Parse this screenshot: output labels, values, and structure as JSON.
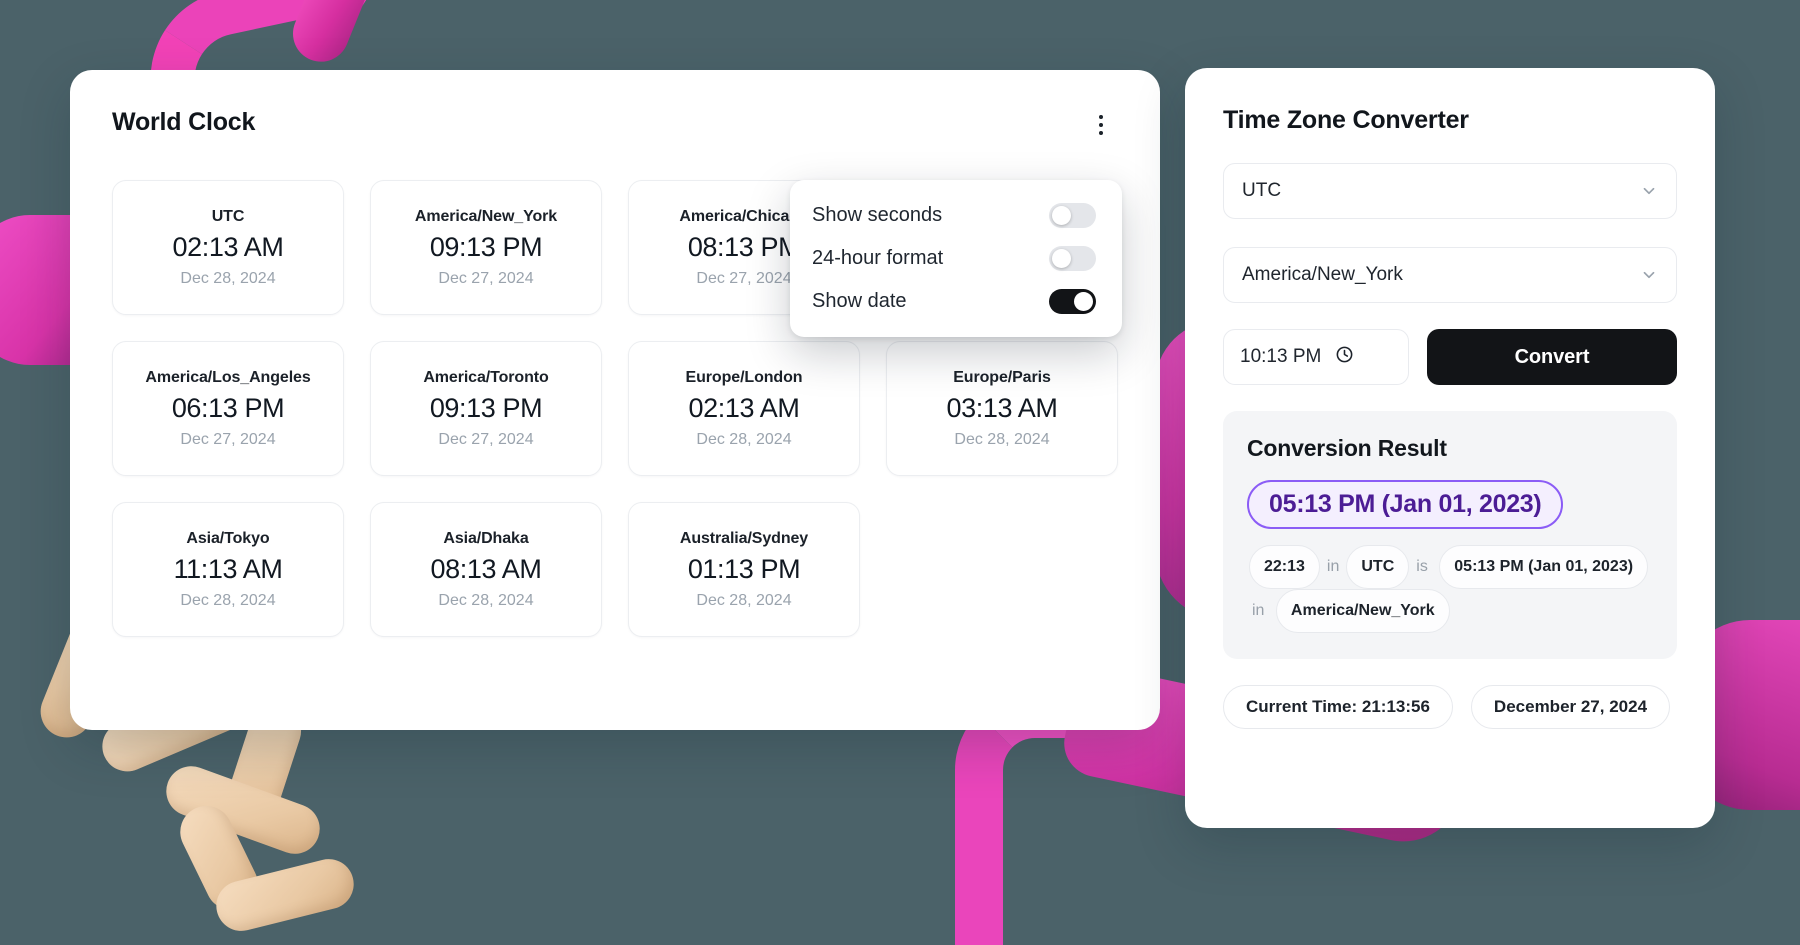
{
  "world_clock": {
    "title": "World Clock",
    "menu_icon": "kebab-menu-icon",
    "clocks": [
      {
        "zone": "UTC",
        "time": "02:13 AM",
        "date": "Dec 28, 2024"
      },
      {
        "zone": "America/New_York",
        "time": "09:13 PM",
        "date": "Dec 27, 2024"
      },
      {
        "zone": "America/Chicago",
        "time": "08:13 PM",
        "date": "Dec 27, 2024"
      },
      {
        "zone": "",
        "time": "",
        "date": ""
      },
      {
        "zone": "America/Los_Angeles",
        "time": "06:13 PM",
        "date": "Dec 27, 2024"
      },
      {
        "zone": "America/Toronto",
        "time": "09:13 PM",
        "date": "Dec 27, 2024"
      },
      {
        "zone": "Europe/London",
        "time": "02:13 AM",
        "date": "Dec 28, 2024"
      },
      {
        "zone": "Europe/Paris",
        "time": "03:13 AM",
        "date": "Dec 28, 2024"
      },
      {
        "zone": "Asia/Tokyo",
        "time": "11:13 AM",
        "date": "Dec 28, 2024"
      },
      {
        "zone": "Asia/Dhaka",
        "time": "08:13 AM",
        "date": "Dec 28, 2024"
      },
      {
        "zone": "Australia/Sydney",
        "time": "01:13 PM",
        "date": "Dec 28, 2024"
      }
    ]
  },
  "settings_menu": {
    "items": [
      {
        "label": "Show seconds",
        "enabled": false
      },
      {
        "label": "24-hour format",
        "enabled": false
      },
      {
        "label": "Show date",
        "enabled": true
      }
    ]
  },
  "converter": {
    "title": "Time Zone Converter",
    "from_zone": "UTC",
    "to_zone": "America/New_York",
    "time_value": "10:13 PM",
    "clock_icon": "clock-icon",
    "chevron_icon": "chevron-down-icon",
    "convert_label": "Convert",
    "result": {
      "title": "Conversion Result",
      "badge": "05:13 PM (Jan 01, 2023)",
      "source_time": "22:13",
      "connector_1": "in",
      "source_zone": "UTC",
      "connector_2": "is",
      "target_time": "05:13 PM (Jan 01, 2023)",
      "connector_3": "in",
      "target_zone": "America/New_York"
    },
    "status": {
      "current_time": "Current Time: 21:13:56",
      "current_date": "December 27, 2024"
    }
  },
  "colors": {
    "background": "#4b6269",
    "accent_purple": "#8b5cf6",
    "result_text": "#4c1d95",
    "button_dark": "#121417",
    "pink_decor": "#e040b0",
    "teal_decor": "#49c9c2",
    "beige_decor": "#e9c9a4"
  }
}
